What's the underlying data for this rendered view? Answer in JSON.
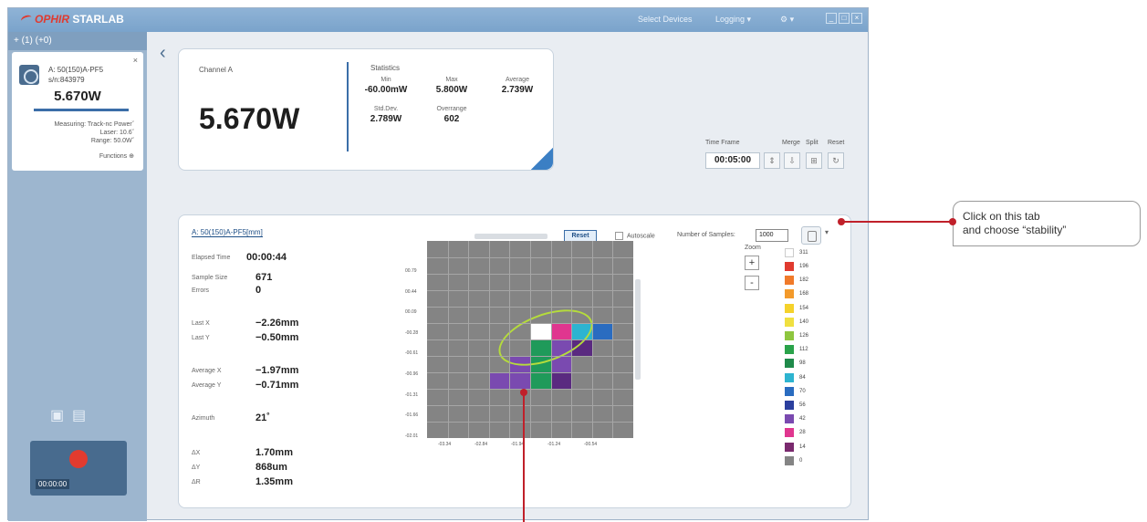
{
  "window": {
    "brand": "OPHIR",
    "app_name": "STARLAB",
    "menu_select_devices": "Select Devices",
    "menu_logging": "Logging ▾",
    "menu_settings": "⚙ ▾"
  },
  "sidebar": {
    "header": "+  (1) (+0)",
    "device": {
      "name_line1": "A: 50(150)A-PF5",
      "name_line2": "s/n:843979",
      "value": "5.670W",
      "info_line1": "Measuring: Track-nc Powerˇ",
      "info_line2": "Laser: 10.6ˇ",
      "info_line3": "Range: 50.0Wˇ",
      "functions_label": "Functions"
    },
    "rec_time": "00:00:00"
  },
  "stats": {
    "channel_label": "Channel A",
    "main_value": "5.670W",
    "title": "Statistics",
    "min_label": "Min",
    "min_value": "-60.00mW",
    "max_label": "Max",
    "max_value": "5.800W",
    "avg_label": "Average",
    "avg_value": "2.739W",
    "std_label": "Std.Dev.",
    "std_value": "2.789W",
    "over_label": "Overrange",
    "over_value": "602"
  },
  "timeframe": {
    "label": "Time Frame",
    "value": "00:05:00",
    "merge_label": "Merge",
    "split_label": "Split",
    "reset_label": "Reset"
  },
  "panel": {
    "tab_label": "A: 50(150)A-PF5[mm]",
    "reset_button": "Reset",
    "autoscale_label": "Autoscale",
    "samples_label": "Number of Samples:",
    "samples_value": "1000",
    "view_dropdown": "▾",
    "measurements": [
      {
        "label": "Elapsed Time",
        "value": "00:00:44"
      },
      {
        "label": "Sample Size",
        "value": "671"
      },
      {
        "label": "Errors",
        "value": "0"
      },
      {
        "label": "Last X",
        "value": "−2.26mm"
      },
      {
        "label": "Last Y",
        "value": "−0.50mm"
      },
      {
        "label": "Average X",
        "value": "−1.97mm"
      },
      {
        "label": "Average Y",
        "value": "−0.71mm"
      },
      {
        "label": "Azimuth",
        "value": "21˚"
      },
      {
        "label": "ΔX",
        "value": "1.70mm"
      },
      {
        "label": "ΔY",
        "value": "868um"
      },
      {
        "label": "ΔR",
        "value": "1.35mm"
      }
    ],
    "zoom_label": "Zoom",
    "zoom_in": "+",
    "zoom_out": "-"
  },
  "heatmap": {
    "y_ticks": [
      "00.79",
      "00.44",
      "00.09",
      "-00.28",
      "-00.61",
      "-00.96",
      "-01.31",
      "-01.66",
      "-02.01"
    ],
    "x_ticks": [
      "-03.34",
      "-02.84",
      "-01.94",
      "-01.24",
      "-00.54"
    ],
    "cells": [
      {
        "col": 5,
        "row": 5,
        "color": "#ffffff"
      },
      {
        "col": 6,
        "row": 5,
        "color": "#e0368f"
      },
      {
        "col": 7,
        "row": 5,
        "color": "#2db4d0"
      },
      {
        "col": 8,
        "row": 5,
        "color": "#2a6cc0"
      },
      {
        "col": 5,
        "row": 6,
        "color": "#1f9a5a"
      },
      {
        "col": 6,
        "row": 6,
        "color": "#7a4ab0"
      },
      {
        "col": 7,
        "row": 6,
        "color": "#5a2a80"
      },
      {
        "col": 4,
        "row": 7,
        "color": "#7a4ab0"
      },
      {
        "col": 5,
        "row": 7,
        "color": "#1f9a5a"
      },
      {
        "col": 6,
        "row": 7,
        "color": "#7a4ab0"
      },
      {
        "col": 3,
        "row": 8,
        "color": "#7a4ab0"
      },
      {
        "col": 4,
        "row": 8,
        "color": "#7a4ab0"
      },
      {
        "col": 5,
        "row": 8,
        "color": "#1f9a5a"
      },
      {
        "col": 6,
        "row": 8,
        "color": "#5a2a80"
      }
    ]
  },
  "legend": [
    {
      "value": "311",
      "color": "#ffffff"
    },
    {
      "value": "196",
      "color": "#e03a2f"
    },
    {
      "value": "182",
      "color": "#f07a2a"
    },
    {
      "value": "168",
      "color": "#f39a2b"
    },
    {
      "value": "154",
      "color": "#f5d22b"
    },
    {
      "value": "140",
      "color": "#f0e040"
    },
    {
      "value": "126",
      "color": "#8ec63f"
    },
    {
      "value": "112",
      "color": "#2aa34a"
    },
    {
      "value": "98",
      "color": "#1f8a4a"
    },
    {
      "value": "84",
      "color": "#2db4d0"
    },
    {
      "value": "70",
      "color": "#2a6cc0"
    },
    {
      "value": "56",
      "color": "#2b3f9e"
    },
    {
      "value": "42",
      "color": "#7a4ab0"
    },
    {
      "value": "28",
      "color": "#e0368f"
    },
    {
      "value": "14",
      "color": "#7a2a6e"
    },
    {
      "value": "0",
      "color": "#848484"
    }
  ],
  "annotation": {
    "line1": "Click on this tab",
    "line2": "and choose “stability”"
  }
}
